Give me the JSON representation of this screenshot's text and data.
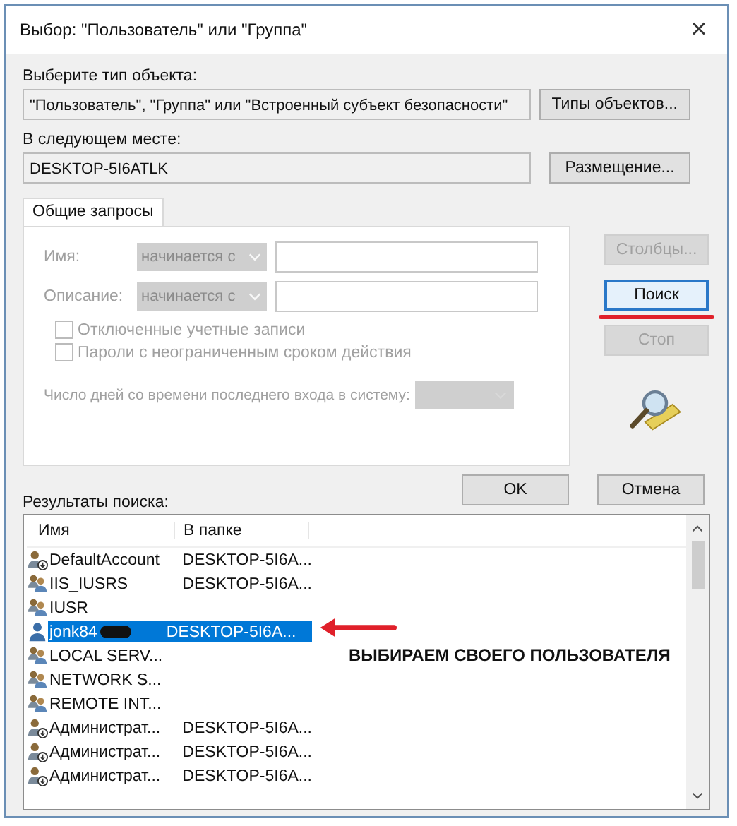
{
  "window": {
    "title": "Выбор: \"Пользователь\" или \"Группа\"",
    "close": "×"
  },
  "object_type": {
    "label": "Выберите тип объекта:",
    "value": "\"Пользователь\", \"Группа\" или \"Встроенный субъект безопасности\"",
    "button": "Типы объектов..."
  },
  "location": {
    "label": "В следующем месте:",
    "value": "DESKTOP-5I6ATLK",
    "button": "Размещение..."
  },
  "tabs": [
    {
      "label": "Общие запросы",
      "selected": true
    }
  ],
  "query": {
    "fields": [
      {
        "label": "Имя:",
        "operator": "начинается с",
        "disabled": true
      },
      {
        "label": "Описание:",
        "operator": "начинается с",
        "disabled": true
      }
    ],
    "checkboxes": [
      {
        "label": "Отключенные учетные записи",
        "checked": false,
        "disabled": true
      },
      {
        "label": "Пароли с неограниченным сроком действия",
        "checked": false,
        "disabled": true
      }
    ],
    "days": {
      "label": "Число дней со времени последнего входа в систему:",
      "disabled": true
    }
  },
  "side_buttons": [
    {
      "label": "Столбцы...",
      "disabled": true,
      "focused": false
    },
    {
      "label": "Поиск",
      "disabled": false,
      "focused": true
    },
    {
      "label": "Стоп",
      "disabled": true,
      "focused": false
    }
  ],
  "dialog_buttons": [
    "OK",
    "Отмена"
  ],
  "results": {
    "label": "Результаты поиска:",
    "columns": [
      "Имя",
      "В папке"
    ],
    "rows": [
      {
        "kind": "user",
        "name": "DefaultAccount",
        "folder": "DESKTOP-5I6A...",
        "selected": false
      },
      {
        "kind": "group",
        "name": "IIS_IUSRS",
        "folder": "DESKTOP-5I6A...",
        "selected": false
      },
      {
        "kind": "group",
        "name": "IUSR",
        "folder": "",
        "selected": false
      },
      {
        "kind": "person",
        "name": "jonk84",
        "folder": "DESKTOP-5I6A...",
        "selected": true,
        "redacted": true
      },
      {
        "kind": "group",
        "name": "LOCAL SERV...",
        "folder": "",
        "selected": false
      },
      {
        "kind": "group",
        "name": "NETWORK S...",
        "folder": "",
        "selected": false
      },
      {
        "kind": "group",
        "name": "REMOTE INT...",
        "folder": "",
        "selected": false
      },
      {
        "kind": "user",
        "name": "Администрат...",
        "folder": "DESKTOP-5I6A...",
        "selected": false
      },
      {
        "kind": "user",
        "name": "Администрат...",
        "folder": "DESKTOP-5I6A...",
        "selected": false
      },
      {
        "kind": "user",
        "name": "Администрат...",
        "folder": "DESKTOP-5I6A...",
        "selected": false
      }
    ]
  },
  "annotation": {
    "text": "ВЫБИРАЕМ СВОЕГО ПОЛЬЗОВАТЕЛЯ"
  }
}
